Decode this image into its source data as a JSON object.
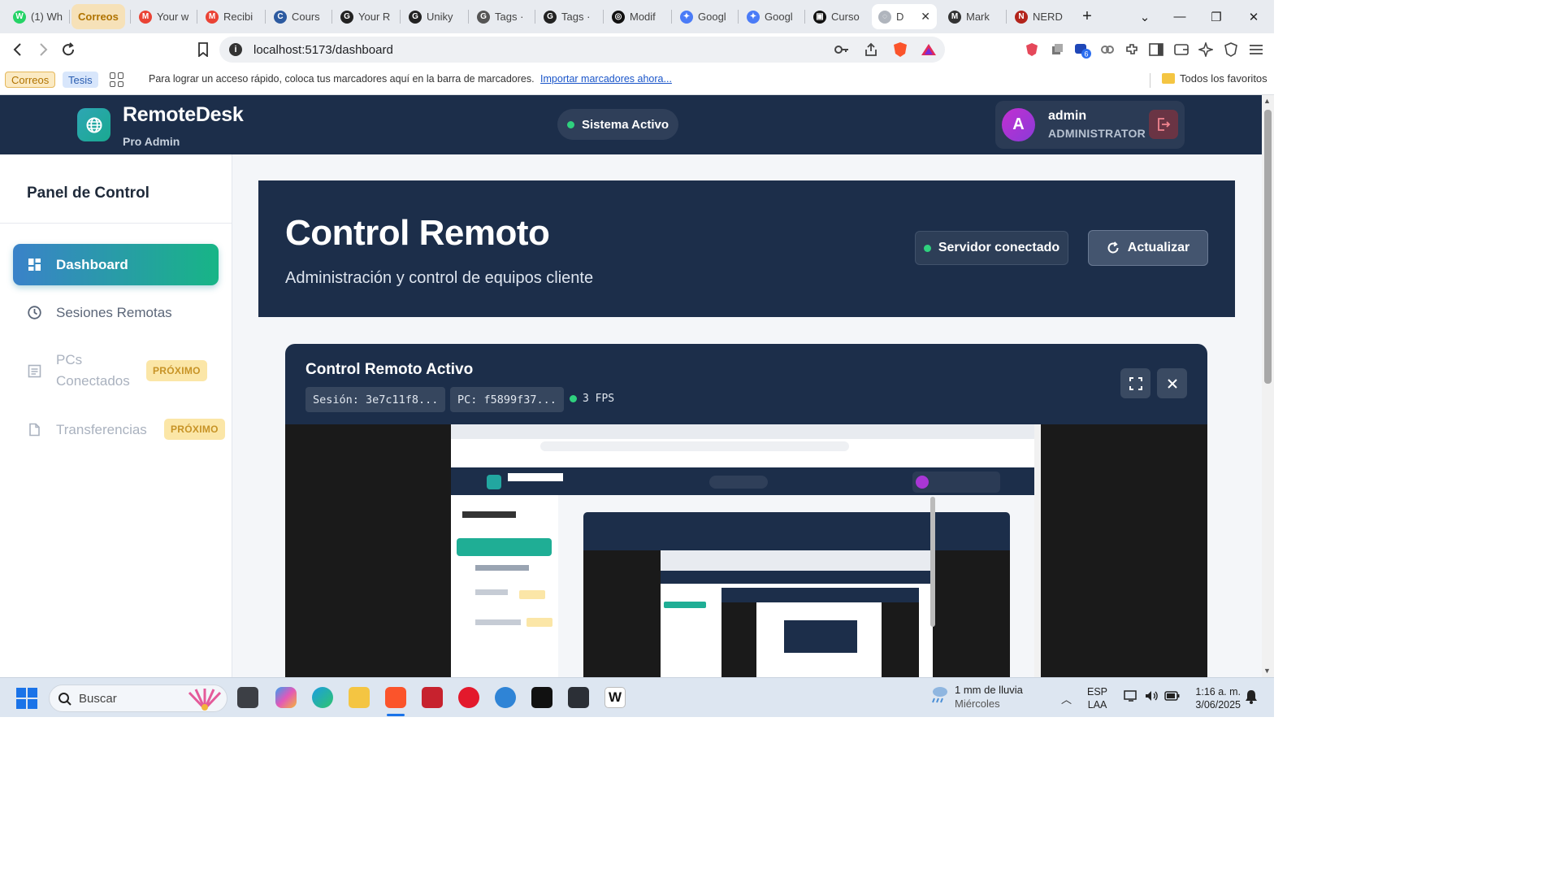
{
  "browser": {
    "tabs": [
      {
        "label": "(1) Wh",
        "fav_color": "#25d366",
        "fav_glyph": "W"
      },
      {
        "label": "Correos",
        "group": true
      },
      {
        "label": "Your w",
        "fav_color": "#ea4335",
        "fav_glyph": "M"
      },
      {
        "label": "Recibi",
        "fav_color": "#ea4335",
        "fav_glyph": "M"
      },
      {
        "label": "Cours",
        "fav_color": "#2c5aa0",
        "fav_glyph": "C"
      },
      {
        "label": "Your R",
        "fav_color": "#222222",
        "fav_glyph": "G"
      },
      {
        "label": "Uniky",
        "fav_color": "#222222",
        "fav_glyph": "G"
      },
      {
        "label": "Tags ·",
        "fav_color": "#555555",
        "fav_glyph": "G"
      },
      {
        "label": "Tags ·",
        "fav_color": "#222222",
        "fav_glyph": "G"
      },
      {
        "label": "Modif",
        "fav_color": "#111111",
        "fav_glyph": "◎"
      },
      {
        "label": "Googl",
        "fav_color": "#4a7bf7",
        "fav_glyph": "✦"
      },
      {
        "label": "Googl",
        "fav_color": "#4a7bf7",
        "fav_glyph": "✦"
      },
      {
        "label": "Curso",
        "fav_color": "#111111",
        "fav_glyph": "▣"
      },
      {
        "label": "D",
        "fav_color": "#b0b5bd",
        "fav_glyph": "◌",
        "active": true
      },
      {
        "label": "Mark",
        "fav_color": "#333333",
        "fav_glyph": "M"
      },
      {
        "label": "NERD",
        "fav_color": "#b3241c",
        "fav_glyph": "N"
      }
    ],
    "new_tab": "+",
    "url": "localhost:5173/dashboard",
    "bookmarks": {
      "chip_correos": "Correos",
      "chip_tesis": "Tesis",
      "hint": "Para lograr un acceso rápido, coloca tus marcadores aquí en la barra de marcadores.",
      "import_link": "Importar marcadores ahora...",
      "all_favorites": "Todos los favoritos"
    }
  },
  "app": {
    "brand": "RemoteDesk",
    "brand_sub": "Pro Admin",
    "system_status": "Sistema Activo",
    "user": {
      "initial": "A",
      "name": "admin",
      "role": "ADMINISTRATOR"
    },
    "colors": {
      "header": "#1c2e4a",
      "accent_from": "#3a82c9",
      "accent_to": "#17b586",
      "status_green": "#2fd17e",
      "soon_badge": "#fbe6a7"
    }
  },
  "sidebar": {
    "title": "Panel de Control",
    "items": [
      {
        "label": "Dashboard",
        "icon": "dashboard-grid-icon",
        "active": true
      },
      {
        "label": "Sesiones Remotas",
        "icon": "clock-icon"
      },
      {
        "label": "PCs Conectados",
        "icon": "document-icon",
        "badge": "PRÓXIMO",
        "disabled": true
      },
      {
        "label": "Transferencias",
        "icon": "file-icon",
        "badge": "PRÓXIMO",
        "disabled": true
      }
    ]
  },
  "hero": {
    "title": "Control Remoto",
    "subtitle": "Administración y control de equipos cliente",
    "server_status": "Servidor conectado",
    "refresh_label": "Actualizar"
  },
  "remote": {
    "title": "Control Remoto Activo",
    "session": "Sesión: 3e7c11f8...",
    "pc": "PC: f5899f37...",
    "fps": "3 FPS"
  },
  "taskbar": {
    "search_placeholder": "Buscar",
    "weather_line1": "1 mm de lluvia",
    "weather_line2": "Miércoles",
    "lang_line1": "ESP",
    "lang_line2": "LAA",
    "time": "1:16 a. m.",
    "date": "3/06/2025"
  }
}
